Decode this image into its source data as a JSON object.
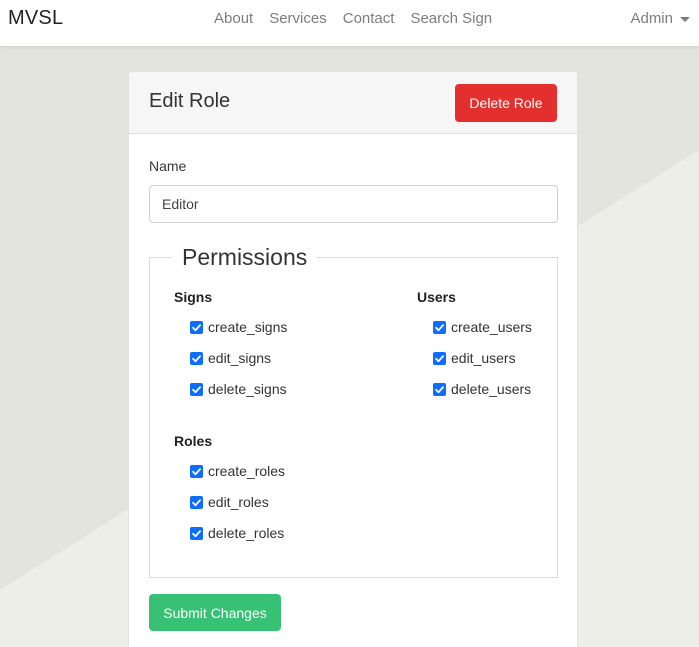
{
  "nav": {
    "brand": "MVSL",
    "links": [
      "About",
      "Services",
      "Contact",
      "Search Sign"
    ],
    "user_menu": "Admin"
  },
  "card": {
    "title": "Edit Role",
    "delete_label": "Delete Role",
    "name_label": "Name",
    "name_value": "Editor",
    "permissions_legend": "Permissions",
    "groups": [
      {
        "title": "Signs",
        "items": [
          "create_signs",
          "edit_signs",
          "delete_signs"
        ]
      },
      {
        "title": "Users",
        "items": [
          "create_users",
          "edit_users",
          "delete_users"
        ]
      },
      {
        "title": "Roles",
        "items": [
          "create_roles",
          "edit_roles",
          "delete_roles"
        ]
      }
    ],
    "submit_label": "Submit Changes"
  },
  "colors": {
    "delete_button": "#e3302f",
    "submit_button": "#36c174",
    "checkbox": "#0d6efd"
  }
}
